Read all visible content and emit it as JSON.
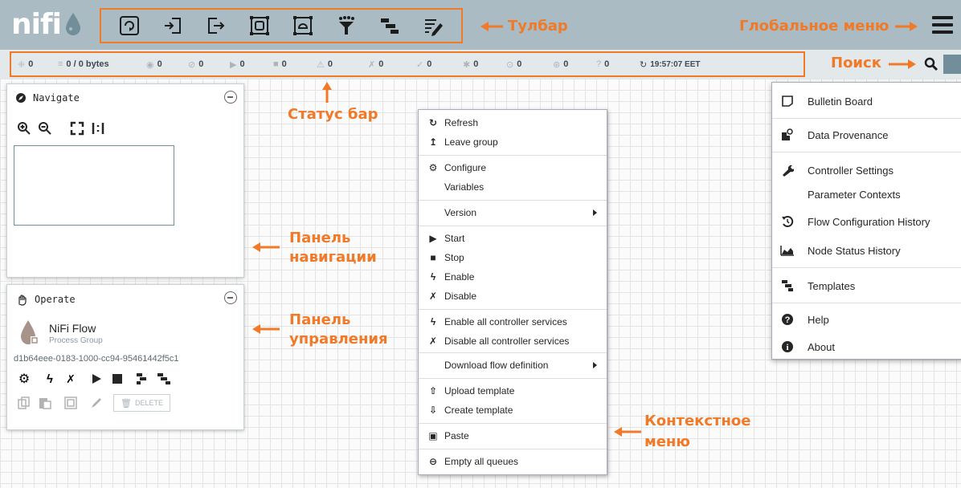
{
  "app": {
    "logo_text": "nifi"
  },
  "annotations": {
    "toolbar": "Тулбар",
    "global_menu": "Глобальное меню",
    "search": "Поиск",
    "status_bar": "Статус бар",
    "nav_panel_l1": "Панель",
    "nav_panel_l2": "навигации",
    "op_panel_l1": "Панель",
    "op_panel_l2": "управления",
    "context_menu_l1": "Контекстное",
    "context_menu_l2": "меню"
  },
  "toolbar": {
    "icons": [
      "processor-icon",
      "input-port-icon",
      "output-port-icon",
      "process-group-icon",
      "remote-process-group-icon",
      "funnel-icon",
      "template-icon",
      "label-icon"
    ]
  },
  "status": {
    "items": [
      {
        "icon": "cluster-icon",
        "value": "0"
      },
      {
        "icon": "queue-icon",
        "value": "0 / 0 bytes"
      },
      {
        "icon": "transmitting-icon",
        "value": "0"
      },
      {
        "icon": "not-transmitting-icon",
        "value": "0"
      },
      {
        "icon": "running-icon",
        "value": "0"
      },
      {
        "icon": "stopped-icon",
        "value": "0"
      },
      {
        "icon": "invalid-icon",
        "value": "0"
      },
      {
        "icon": "disabled-icon",
        "value": "0"
      },
      {
        "icon": "up-to-date-icon",
        "value": "0"
      },
      {
        "icon": "locally-modified-icon",
        "value": "0"
      },
      {
        "icon": "stale-icon",
        "value": "0"
      },
      {
        "icon": "locally-modified-stale-icon",
        "value": "0"
      },
      {
        "icon": "sync-failure-icon",
        "value": "0"
      },
      {
        "icon": "refresh-icon",
        "value": "19:57:07 EET"
      }
    ]
  },
  "navigate": {
    "title": "Navigate"
  },
  "operate": {
    "title": "Operate",
    "name": "NiFi Flow",
    "type": "Process Group",
    "id": "d1b64eee-0183-1000-cc94-95461442f5c1",
    "delete_label": "DELETE"
  },
  "context_menu": {
    "items": [
      {
        "label": "Refresh",
        "icon": "↻"
      },
      {
        "label": "Leave group",
        "icon": "↥"
      },
      {
        "label": "Configure",
        "icon": "⚙"
      },
      {
        "label": "Variables",
        "icon": ""
      },
      {
        "label": "Version",
        "icon": ""
      },
      {
        "label": "Start",
        "icon": "▶"
      },
      {
        "label": "Stop",
        "icon": "■"
      },
      {
        "label": "Enable",
        "icon": "ϟ"
      },
      {
        "label": "Disable",
        "icon": "✗"
      },
      {
        "label": "Enable all controller services",
        "icon": "ϟ"
      },
      {
        "label": "Disable all controller services",
        "icon": "✗"
      },
      {
        "label": "Download flow definition",
        "icon": ""
      },
      {
        "label": "Upload template",
        "icon": "⇧"
      },
      {
        "label": "Create template",
        "icon": "⇩"
      },
      {
        "label": "Paste",
        "icon": "▣"
      },
      {
        "label": "Empty all queues",
        "icon": "⊖"
      }
    ]
  },
  "global_menu": {
    "items": [
      {
        "label": "Bulletin Board"
      },
      {
        "label": "Data Provenance"
      },
      {
        "label": "Controller Settings"
      },
      {
        "label": "Parameter Contexts"
      },
      {
        "label": "Flow Configuration History"
      },
      {
        "label": "Node Status History"
      },
      {
        "label": "Templates"
      },
      {
        "label": "Help"
      },
      {
        "label": "About"
      }
    ]
  },
  "colors": {
    "accent": "#f07a28",
    "header": "#aabbc3",
    "status": "#e3e8eb",
    "dark": "#262626"
  }
}
